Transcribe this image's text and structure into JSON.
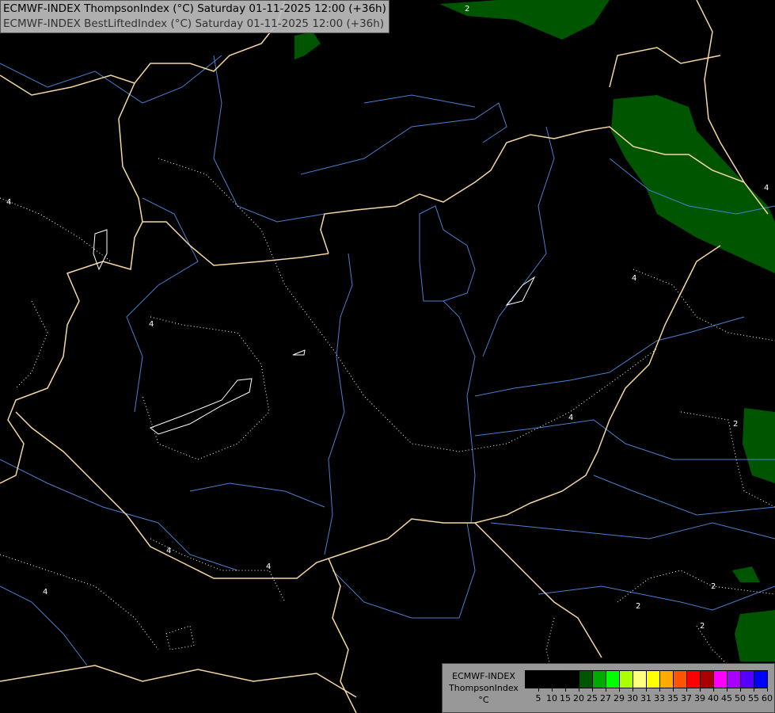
{
  "title": {
    "line1": "ECMWF-INDEX ThompsonIndex (°C) Saturday 01-11-2025 12:00 (+36h)",
    "line2": "ECMWF-INDEX BestLiftedIndex (°C) Saturday 01-11-2025 12:00 (+36h)"
  },
  "legend": {
    "line1": "ECMWF-INDEX",
    "line2": "ThompsonIndex",
    "unit": "°C",
    "colors": [
      "#000000",
      "#000000",
      "#000000",
      "#000000",
      "#005500",
      "#00aa00",
      "#00ff00",
      "#aaff00",
      "#ffff80",
      "#ffff00",
      "#ffaa00",
      "#ff5500",
      "#ff0000",
      "#aa0000",
      "#ff00ff",
      "#aa00ff",
      "#5500ff",
      "#0000ff"
    ],
    "ticks": [
      "5",
      "10",
      "15",
      "20",
      "25",
      "27",
      "29",
      "30",
      "31",
      "33",
      "35",
      "37",
      "39",
      "40",
      "45",
      "50",
      "55",
      "60"
    ]
  },
  "map": {
    "border_color": "#f5d7a0",
    "river_color": "#4a7fd0",
    "fill_color": "#005500",
    "contour_labels": [
      "4",
      "4",
      "4",
      "4",
      "4",
      "4",
      "4",
      "2",
      "2",
      "2",
      "2",
      "2",
      "4"
    ]
  }
}
